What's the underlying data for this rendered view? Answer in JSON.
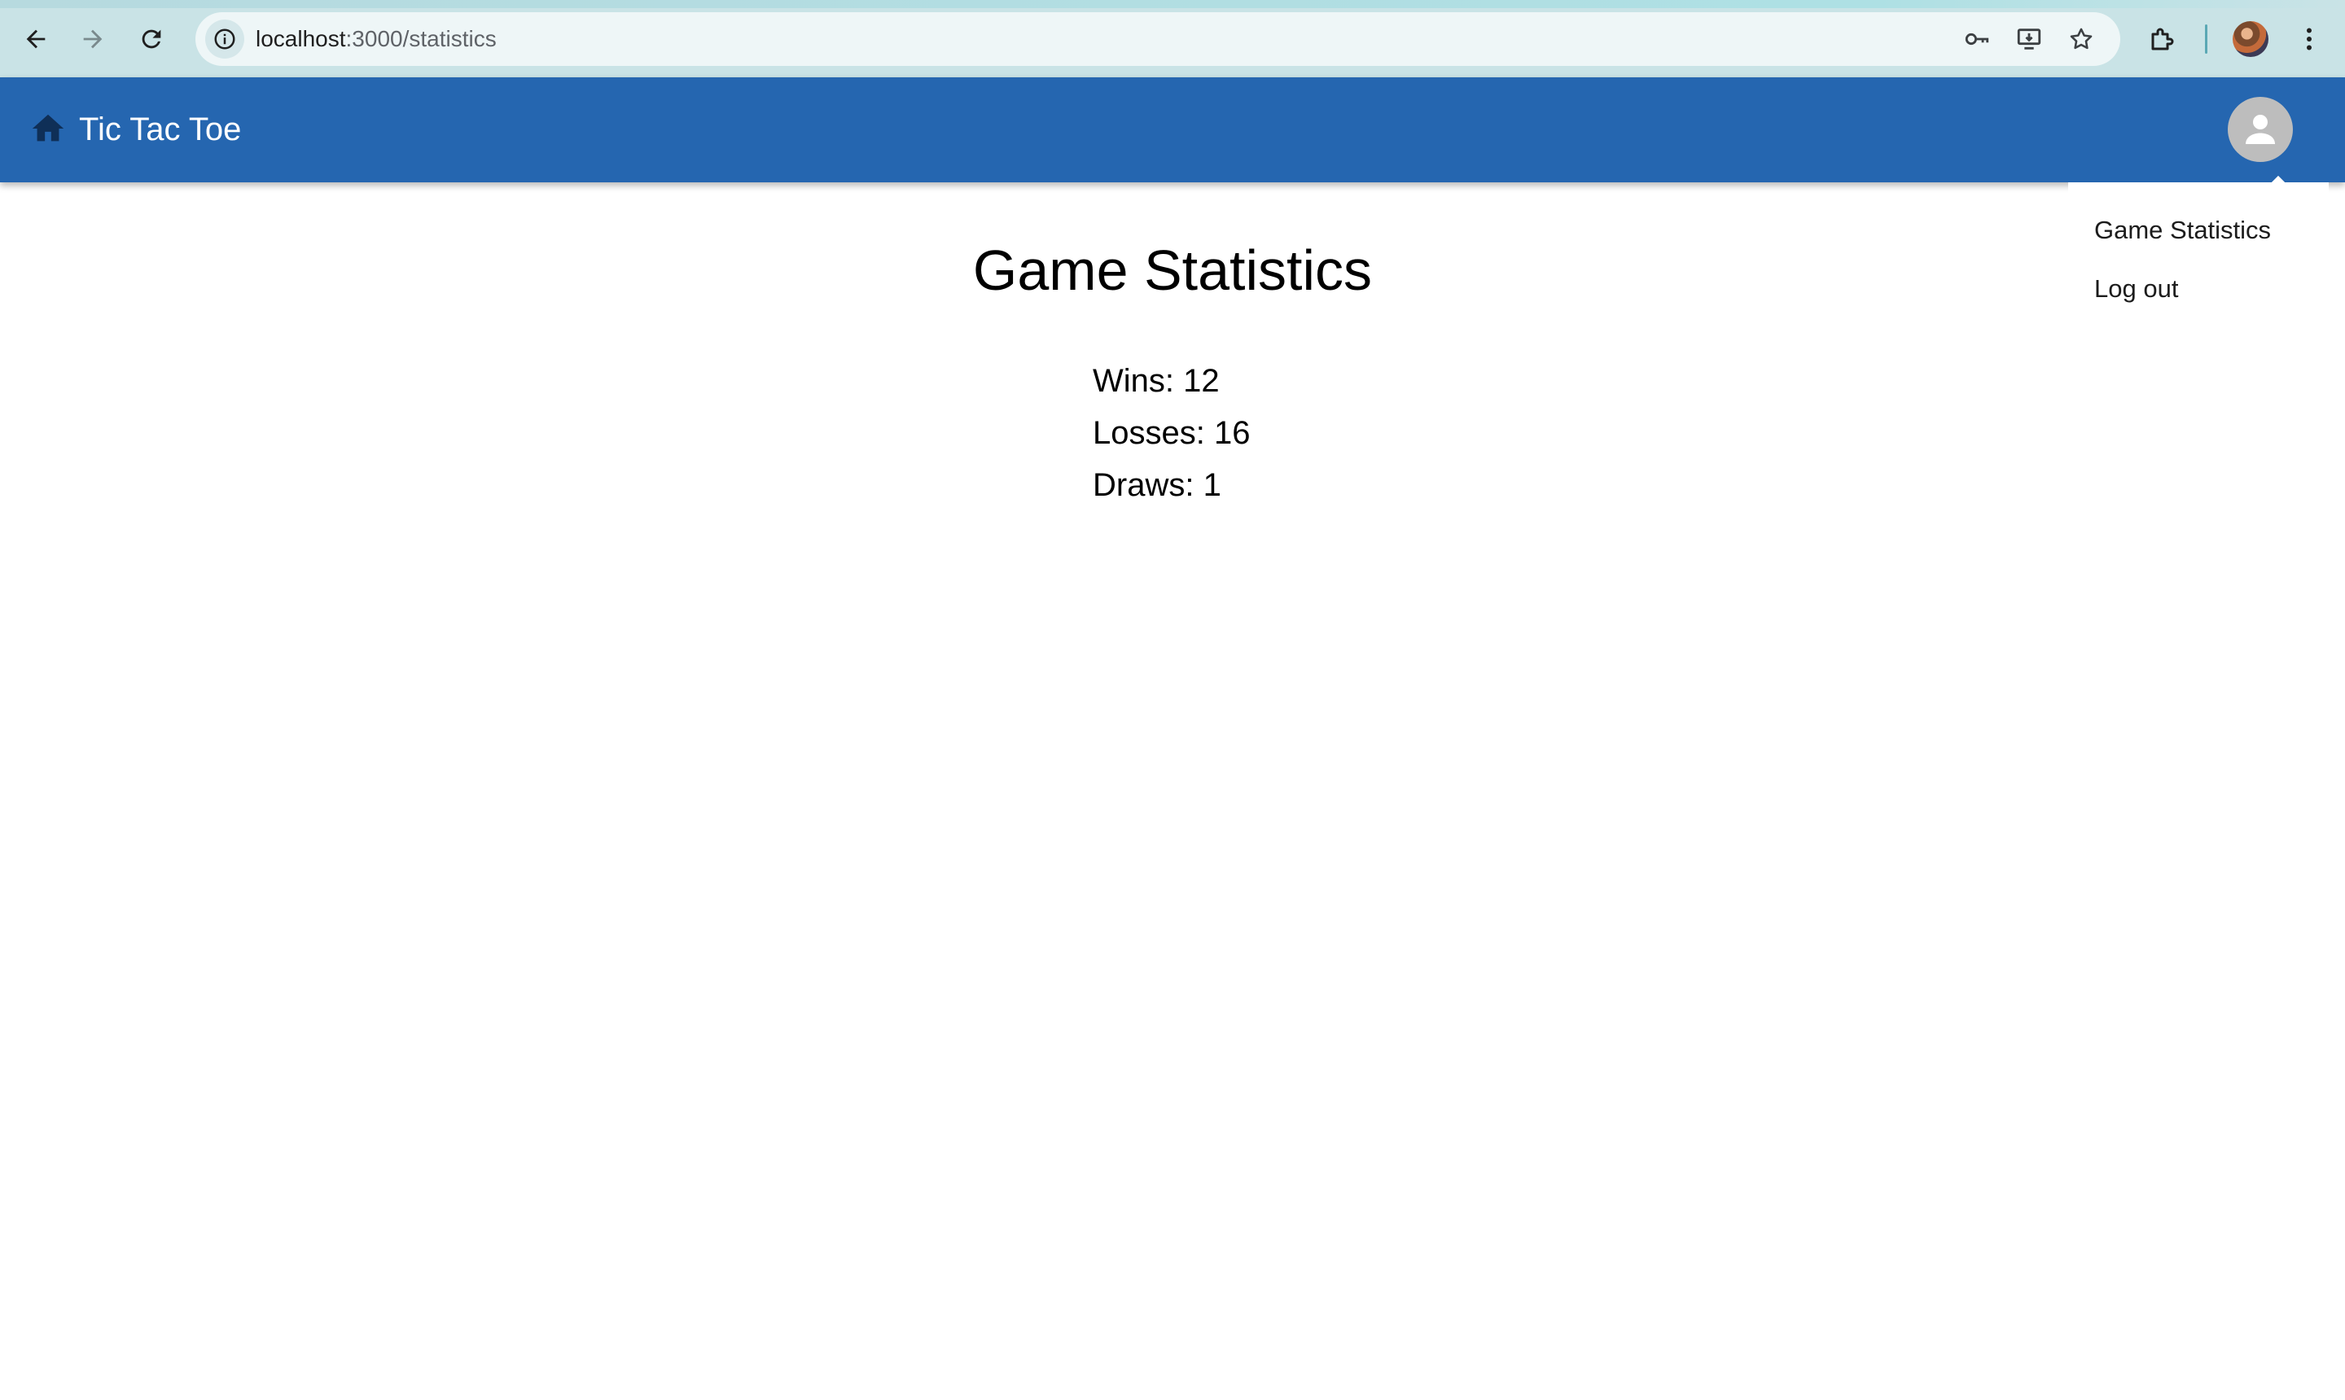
{
  "browser": {
    "url_host": "localhost",
    "url_path": ":3000/statistics"
  },
  "header": {
    "title": "Tic Tac Toe"
  },
  "user_menu": {
    "items": [
      {
        "label": "Game Statistics"
      },
      {
        "label": "Log out"
      }
    ]
  },
  "main": {
    "title": "Game Statistics",
    "stats": [
      {
        "label": "Wins: 12"
      },
      {
        "label": "Losses: 16"
      },
      {
        "label": "Draws: 1"
      }
    ]
  },
  "colors": {
    "appbar": "#2566b0",
    "chrome": "#c9e3e6",
    "avatar_bg": "#bdbdbd"
  }
}
